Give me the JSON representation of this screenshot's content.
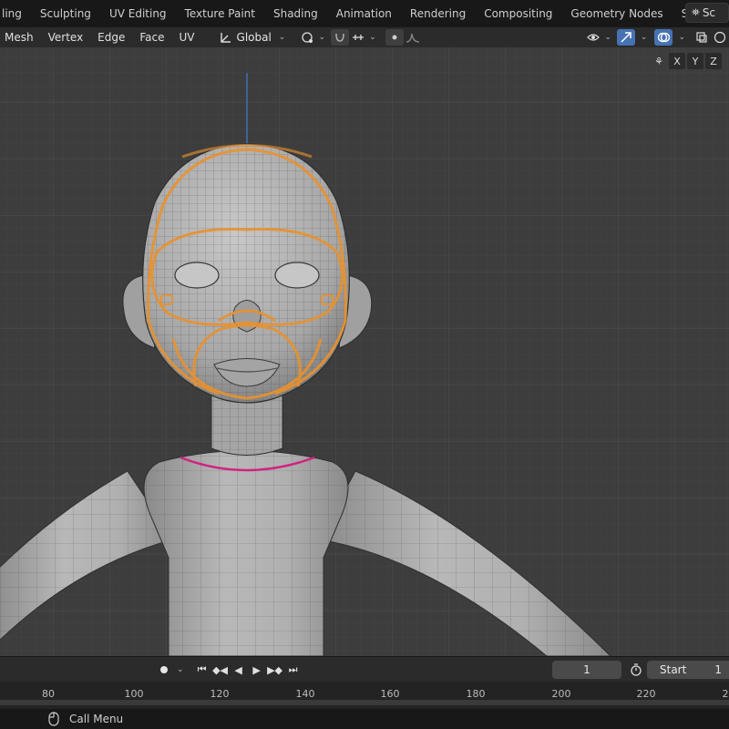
{
  "workspace_tabs": [
    "ling",
    "Sculpting",
    "UV Editing",
    "Texture Paint",
    "Shading",
    "Animation",
    "Rendering",
    "Compositing",
    "Geometry Nodes",
    "Scripting"
  ],
  "scene_label": "Sc",
  "header": {
    "menus": [
      "Mesh",
      "Vertex",
      "Edge",
      "Face",
      "UV"
    ],
    "transform_orientation": "Global"
  },
  "viewport": {
    "mirror_axes": [
      "X",
      "Y",
      "Z"
    ]
  },
  "timeline": {
    "current_frame": "1",
    "start_label": "Start",
    "start_value": "1",
    "ruler_ticks": [
      "80",
      "100",
      "120",
      "140",
      "160",
      "180",
      "200",
      "220",
      "2"
    ]
  },
  "status": {
    "hint": "Call Menu"
  },
  "colors": {
    "viewport_bg": "#3d3d3d",
    "grid_line": "#464646",
    "selection_orange": "#e8922f",
    "seam_magenta": "#d0237f",
    "active_blue": "#4772b3"
  }
}
